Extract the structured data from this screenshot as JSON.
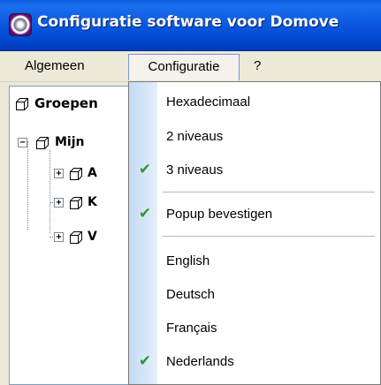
{
  "window": {
    "title": "Configuratie software voor Domove"
  },
  "menubar": {
    "items": [
      {
        "label": "Algemeen"
      },
      {
        "label": "Configuratie",
        "active": true
      },
      {
        "label": "?"
      }
    ]
  },
  "tree": {
    "header": "Groepen",
    "root_label": "Mijn",
    "children": [
      {
        "label": "A"
      },
      {
        "label": "K"
      },
      {
        "label": "V"
      }
    ]
  },
  "dropdown": {
    "items": [
      {
        "label": "Hexadecimaal",
        "checked": false
      },
      {
        "label": "2 niveaus",
        "checked": false
      },
      {
        "label": "3 niveaus",
        "checked": true
      },
      {
        "label": "Popup bevestigen",
        "checked": true
      },
      {
        "label": "English",
        "checked": false
      },
      {
        "label": "Deutsch",
        "checked": false
      },
      {
        "label": "Français",
        "checked": false
      },
      {
        "label": "Nederlands",
        "checked": true
      }
    ],
    "check_glyph": "✔",
    "check_color": "#2c9a2c"
  }
}
